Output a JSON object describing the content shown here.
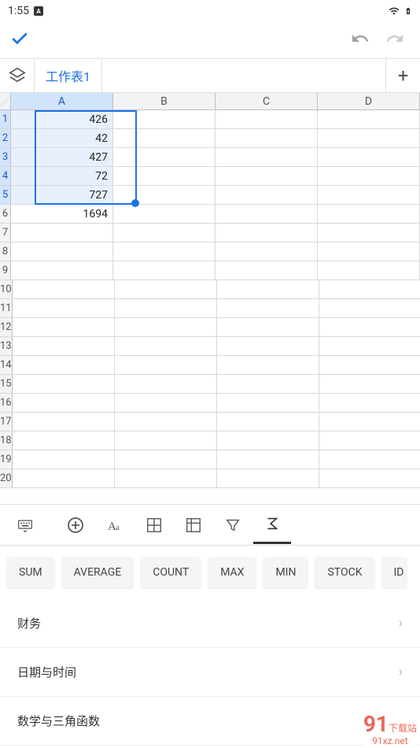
{
  "status": {
    "time": "1:55",
    "icon_label": "A"
  },
  "toolbar": {
    "confirm": "✓"
  },
  "tabs": {
    "sheet_name": "工作表1",
    "add": "+"
  },
  "columns": [
    "A",
    "B",
    "C",
    "D"
  ],
  "rows": [
    {
      "n": "1",
      "a": "426"
    },
    {
      "n": "2",
      "a": "42"
    },
    {
      "n": "3",
      "a": "427"
    },
    {
      "n": "4",
      "a": "72"
    },
    {
      "n": "5",
      "a": "727"
    },
    {
      "n": "6",
      "a": "1694"
    },
    {
      "n": "7",
      "a": ""
    },
    {
      "n": "8",
      "a": ""
    },
    {
      "n": "9",
      "a": ""
    },
    {
      "n": "10",
      "a": ""
    },
    {
      "n": "11",
      "a": ""
    },
    {
      "n": "12",
      "a": ""
    },
    {
      "n": "13",
      "a": ""
    },
    {
      "n": "14",
      "a": ""
    },
    {
      "n": "15",
      "a": ""
    },
    {
      "n": "16",
      "a": ""
    },
    {
      "n": "17",
      "a": ""
    },
    {
      "n": "18",
      "a": ""
    },
    {
      "n": "19",
      "a": ""
    },
    {
      "n": "20",
      "a": ""
    }
  ],
  "selection": {
    "from_row": 1,
    "to_row": 5,
    "col": "A"
  },
  "functions": {
    "chips": [
      "SUM",
      "AVERAGE",
      "COUNT",
      "MAX",
      "MIN",
      "STOCK",
      "ID"
    ],
    "categories": [
      "财务",
      "日期与时间",
      "数学与三角函数"
    ]
  },
  "watermark": {
    "brand": "91",
    "cn": "下载站",
    "url": "91xz.net"
  }
}
